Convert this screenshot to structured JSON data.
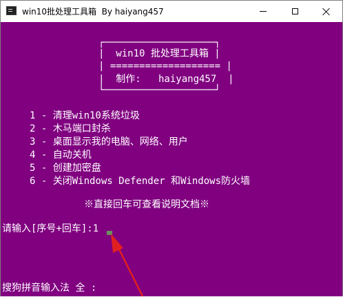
{
  "window": {
    "title": "win10批处理工具箱  By haiyang457"
  },
  "banner": {
    "top_border": "┌───────────────────┐",
    "title_line": "|  win10 批处理工具箱 |",
    "separator": "| =================== |",
    "author_line": "|  制作:   haiyang457  |",
    "bottom_border": "└───────────────────┘"
  },
  "menu": {
    "items": [
      "1 - 清理win10系统垃圾",
      "2 - 木马端口封杀",
      "3 - 桌面显示我的电脑、网络、用户",
      "4 - 自动关机",
      "5 - 创建加密盘",
      "6 - 关闭Windows Defender 和Windows防火墙"
    ],
    "hint": "※直接回车可查看说明文档※"
  },
  "prompt": {
    "text": "请输入[序号+回车]:1"
  },
  "ime": {
    "status": "搜狗拼音输入法 全 :"
  },
  "colors": {
    "console_bg": "#800080",
    "console_fg": "#ffffff",
    "arrow": "#e02020"
  }
}
